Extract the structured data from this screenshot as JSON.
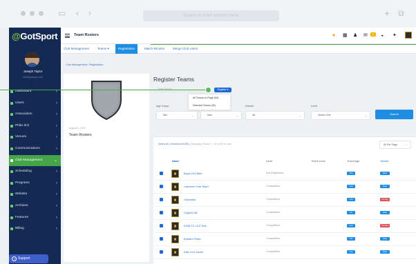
{
  "browser": {
    "url_text": "Search or enter website name"
  },
  "sidebar": {
    "logo_part1": "@",
    "logo_part2": "GotSport",
    "user_name": "Joseph Taylor",
    "user_email": "info@gotsport.com",
    "items": [
      {
        "label": "Dashboard",
        "active": false
      },
      {
        "label": "Users",
        "active": false
      },
      {
        "label": "Association",
        "active": false
      },
      {
        "label": "Phân tích",
        "active": false
      },
      {
        "label": "Venues",
        "active": false
      },
      {
        "label": "Communications",
        "active": false
      },
      {
        "label": "Club Management",
        "active": true
      },
      {
        "label": "Scheduling",
        "active": false
      },
      {
        "label": "Programs",
        "active": false
      },
      {
        "label": "Website",
        "active": false
      },
      {
        "label": "Archives",
        "active": false
      },
      {
        "label": "Features",
        "active": false
      },
      {
        "label": "Billing",
        "active": false
      }
    ],
    "support_label": "Support"
  },
  "header": {
    "title": "Team Rosters",
    "badge_count": "9"
  },
  "tabs": [
    {
      "label": "Club Management"
    },
    {
      "label": "Teams ▾"
    },
    {
      "label": "Registration"
    },
    {
      "label": "Match Minutes"
    },
    {
      "label": "Merge Club Users"
    }
  ],
  "breadcrumb": {
    "text": "Club Management  /  Registration"
  },
  "left_card": {
    "date": "August 2, 2021",
    "name": "Team Rosters"
  },
  "panel": {
    "title": "Register Teams",
    "search_placeholder": "Team Search",
    "register_button": "Register ▾",
    "dropdown_items": [
      {
        "label": "All Teams on Page (50)"
      },
      {
        "label": "Selected Teams (50)"
      }
    ],
    "filters": {
      "age_label": "Age Group",
      "age_min": "Min",
      "age_max": "Max",
      "gender_label": "Gender",
      "gender_value": "All",
      "level_label": "Level",
      "level_value": "Select One",
      "search_button": "Search"
    },
    "select_all": "Select All",
    "deselect_all": "Deselect All (50)",
    "showing": "Displaying Teams 1 - 50 of 80 in total",
    "per_page": "50 Per Page",
    "columns": {
      "name": "Name",
      "level": "Level",
      "event_level": "Event Level",
      "event_age": "Event Age",
      "gender": "Gender"
    },
    "rows": [
      {
        "name": "Boys U14 Blue",
        "level": "Not Registered",
        "age": "U14",
        "gender": "Male",
        "gender_color": "#1f8de2"
      },
      {
        "name": "Cameron Test Team",
        "level": "Competitive",
        "age": "U10",
        "gender": "Male",
        "gender_color": "#1f8de2"
      },
      {
        "name": "Cheetahs",
        "level": "Competitive",
        "age": "U12",
        "gender": "Female",
        "gender_color": "#e0505a"
      },
      {
        "name": "Copper U8",
        "level": "Competitive",
        "age": "U8",
        "gender": "Male",
        "gender_color": "#1f8de2"
      },
      {
        "name": "DOM FC U12 Test",
        "level": "Competitive",
        "age": "U12",
        "gender": "Female",
        "gender_color": "#e0505a"
      },
      {
        "name": "Eastern Flash",
        "level": "Competitive",
        "age": "U11",
        "gender": "Male",
        "gender_color": "#1f8de2"
      },
      {
        "name": "Elite U13 South",
        "level": "Competitive",
        "age": "U13",
        "gender": "Male",
        "gender_color": "#1f8de2"
      }
    ]
  },
  "colors": {
    "sidebar_bg": "#152a52",
    "accent_blue": "#1f8de2",
    "active_green": "#45a548",
    "female_red": "#e0505a"
  }
}
